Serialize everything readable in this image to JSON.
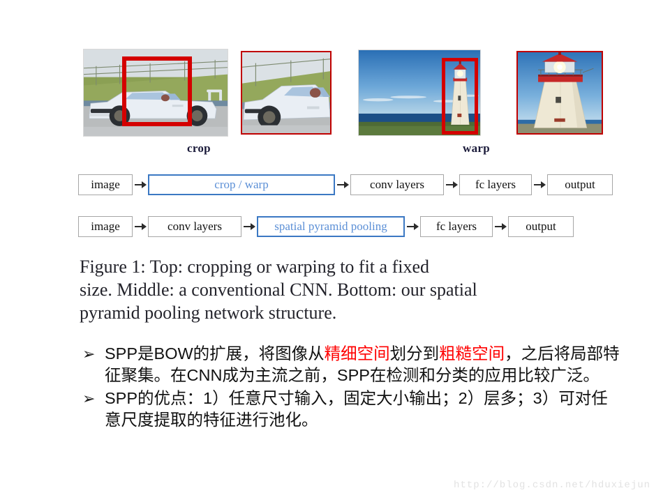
{
  "slide": {
    "figure_block": {
      "crop_caption": "crop",
      "warp_caption": "warp",
      "images": {
        "car_full_alt": "car-photo-with-red-crop-box",
        "car_crop_alt": "cropped-car-photo",
        "lighthouse_full_alt": "lighthouse-photo-with-red-warp-box",
        "lighthouse_warp_alt": "warped-lighthouse-photo"
      }
    },
    "flow_diagrams": [
      {
        "id": "conventional-cnn",
        "nodes": [
          {
            "label": "image",
            "accent": false
          },
          {
            "label": "crop / warp",
            "accent": true
          },
          {
            "label": "conv layers",
            "accent": false
          },
          {
            "label": "fc layers",
            "accent": false
          },
          {
            "label": "output",
            "accent": false
          }
        ]
      },
      {
        "id": "spp-net",
        "nodes": [
          {
            "label": "image",
            "accent": false
          },
          {
            "label": "conv layers",
            "accent": false
          },
          {
            "label": "spatial pyramid pooling",
            "accent": true
          },
          {
            "label": "fc layers",
            "accent": false
          },
          {
            "label": "output",
            "accent": false
          }
        ]
      }
    ],
    "figure_caption": {
      "line1": "Figure 1: Top: cropping or warping to fit a fixed",
      "line2": "size. Middle: a conventional CNN. Bottom: our spatial",
      "line3": "pyramid pooling network structure."
    },
    "bullets": [
      {
        "marker": "➢",
        "segments": [
          {
            "text": "SPP是BOW的扩展，将图像从",
            "color": "default"
          },
          {
            "text": "精细空间",
            "color": "red"
          },
          {
            "text": "划分到",
            "color": "default"
          },
          {
            "text": "粗糙空间",
            "color": "red"
          },
          {
            "text": "，之后将局部特征聚集。在CNN成为主流之前，SPP在检测和分类的应用比较广泛。",
            "color": "default"
          }
        ]
      },
      {
        "marker": "➢",
        "segments": [
          {
            "text": "SPP的优点：1）任意尺寸输入，固定大小输出；2）层多；3）可对任意尺度提取的特征进行池化。",
            "color": "default"
          }
        ]
      }
    ],
    "watermark": "http://blog.csdn.net/hduxiejun",
    "colors": {
      "accent_blue": "#5b8fd6",
      "accent_blue_border": "#3b78c3",
      "annotation_red": "#d40000",
      "highlight_red": "#ff0000",
      "box_border": "#a6a6a6",
      "watermark": "#e2e2e2"
    }
  }
}
